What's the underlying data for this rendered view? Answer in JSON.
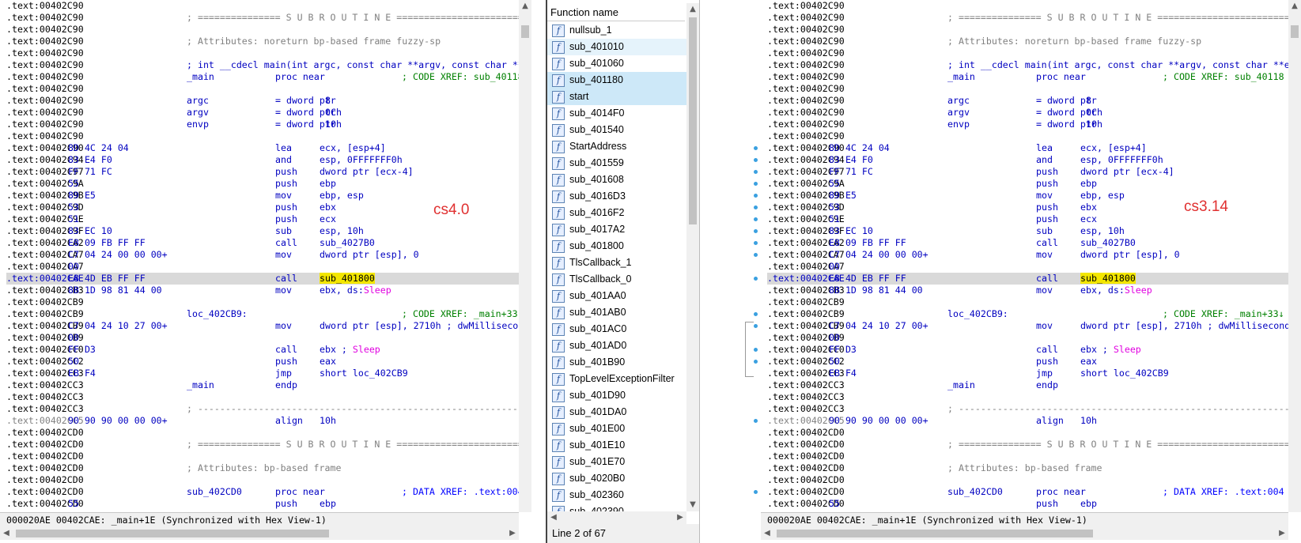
{
  "left_pane": {
    "annotation": "cs4.0",
    "status": "000020AE 00402CAE: _main+1E (Synchronized with Hex View-1)",
    "lines": [
      {
        "addr": ".text:00402C90"
      },
      {
        "addr": ".text:00402C90",
        "comment": "; =============== S U B R O U T I N E ======================================="
      },
      {
        "addr": ".text:00402C90"
      },
      {
        "addr": ".text:00402C90",
        "comment": "; Attributes: noreturn bp-based frame fuzzy-sp"
      },
      {
        "addr": ".text:00402C90"
      },
      {
        "addr": ".text:00402C90",
        "decl": "; int __cdecl main(int argc, const char **argv, const char **e"
      },
      {
        "addr": ".text:00402C90",
        "label": "_main",
        "mnem": "proc near",
        "xref": "; CODE XREF: sub_40118"
      },
      {
        "addr": ".text:00402C90"
      },
      {
        "addr": ".text:00402C90",
        "label": "argc",
        "mnem": "= dword ptr",
        "op": " 8"
      },
      {
        "addr": ".text:00402C90",
        "label": "argv",
        "mnem": "= dword ptr",
        "op": " 0Ch"
      },
      {
        "addr": ".text:00402C90",
        "label": "envp",
        "mnem": "= dword ptr",
        "op": " 10h"
      },
      {
        "addr": ".text:00402C90"
      },
      {
        "addr": ".text:00402C90",
        "bytes": "8D 4C 24 04",
        "mnem": "lea",
        "op": "ecx, [esp+4]"
      },
      {
        "addr": ".text:00402C94",
        "bytes": "83 E4 F0",
        "mnem": "and",
        "op": "esp, 0FFFFFFF0h"
      },
      {
        "addr": ".text:00402C97",
        "bytes": "FF 71 FC",
        "mnem": "push",
        "op": "dword ptr [ecx-4]"
      },
      {
        "addr": ".text:00402C9A",
        "bytes": "55",
        "mnem": "push",
        "op": "ebp"
      },
      {
        "addr": ".text:00402C9B",
        "bytes": "89 E5",
        "mnem": "mov",
        "op": "ebp, esp"
      },
      {
        "addr": ".text:00402C9D",
        "bytes": "53",
        "mnem": "push",
        "op": "ebx"
      },
      {
        "addr": ".text:00402C9E",
        "bytes": "51",
        "mnem": "push",
        "op": "ecx"
      },
      {
        "addr": ".text:00402C9F",
        "bytes": "83 EC 10",
        "mnem": "sub",
        "op": "esp, 10h"
      },
      {
        "addr": ".text:00402CA2",
        "bytes": "E8 09 FB FF FF",
        "mnem": "call",
        "op": "sub_4027B0"
      },
      {
        "addr": ".text:00402CA7",
        "bytes": "C7 04 24 00 00 00+",
        "mnem": "mov",
        "op": "dword ptr [esp], 0"
      },
      {
        "addr": ".text:00402CA7",
        "bytes": "00"
      },
      {
        "addr": ".text:00402CAE",
        "bytes": "E8 4D EB FF FF",
        "mnem": "call",
        "call_target": "sub_401800",
        "highlight": true
      },
      {
        "addr": ".text:00402CB3",
        "bytes": "8B 1D 98 81 44 00",
        "mnem": "mov",
        "op": "ebx, ds:",
        "op_sym": "Sleep"
      },
      {
        "addr": ".text:00402CB9"
      },
      {
        "addr": ".text:00402CB9",
        "label": "loc_402CB9:",
        "xref": "; CODE XREF: _main+33↓"
      },
      {
        "addr": ".text:00402CB9",
        "bytes": "C7 04 24 10 27 00+",
        "mnem": "mov",
        "op": "dword ptr [esp], 2710h ; dwMillisecond"
      },
      {
        "addr": ".text:00402CB9",
        "bytes": "00"
      },
      {
        "addr": ".text:00402CC0",
        "bytes": "FF D3",
        "mnem": "call",
        "op": "ebx ; ",
        "op_sym": "Sleep"
      },
      {
        "addr": ".text:00402CC2",
        "bytes": "50",
        "mnem": "push",
        "op": "eax"
      },
      {
        "addr": ".text:00402CC3",
        "bytes": "EB F4",
        "mnem": "jmp",
        "op": "short loc_402CB9"
      },
      {
        "addr": ".text:00402CC3",
        "label": "_main",
        "mnem": "endp"
      },
      {
        "addr": ".text:00402CC3"
      },
      {
        "addr": ".text:00402CC3",
        "comment": "; ---------------------------------------------------------------------------"
      },
      {
        "addr": ".text:00402CC5",
        "bytes": "90 90 90 00 00 00+",
        "mnem": "align",
        "op": "10h",
        "gray": true
      },
      {
        "addr": ".text:00402CD0"
      },
      {
        "addr": ".text:00402CD0",
        "comment": "; =============== S U B R O U T I N E ======================================="
      },
      {
        "addr": ".text:00402CD0"
      },
      {
        "addr": ".text:00402CD0",
        "comment": "; Attributes: bp-based frame"
      },
      {
        "addr": ".text:00402CD0"
      },
      {
        "addr": ".text:00402CD0",
        "label": "sub_402CD0",
        "mnem": "proc near",
        "xref_blue": "; DATA XREF: .text:004"
      },
      {
        "addr": ".text:00402CD0",
        "bytes": "55",
        "mnem": "push",
        "op": "ebp"
      }
    ]
  },
  "right_pane": {
    "annotation": "cs3.14",
    "status": "000020AE 00402CAE: _main+1E (Synchronized with Hex View-1)"
  },
  "function_list": {
    "header": "Function name",
    "status": "Line 2 of 67",
    "icon_glyph": "f",
    "items": [
      "nullsub_1",
      "sub_401010",
      "sub_401060",
      "sub_401180",
      "start",
      "sub_4014F0",
      "sub_401540",
      "StartAddress",
      "sub_401559",
      "sub_401608",
      "sub_4016D3",
      "sub_4016F2",
      "sub_4017A2",
      "sub_401800",
      "TlsCallback_1",
      "TlsCallback_0",
      "sub_401AA0",
      "sub_401AB0",
      "sub_401AC0",
      "sub_401AD0",
      "sub_401B90",
      "TopLevelExceptionFilter",
      "sub_401D90",
      "sub_401DA0",
      "sub_401E00",
      "sub_401E10",
      "sub_401E70",
      "sub_4020B0",
      "sub_402360",
      "sub_402390"
    ],
    "selected_index": 1,
    "hover_indices": [
      3,
      4
    ]
  },
  "colors": {
    "code_blue": "#0000c0",
    "xref_green": "#008000",
    "symbol_magenta": "#e000e0",
    "highlight_yellow": "#f3e600",
    "annotation_red": "#e03030"
  }
}
